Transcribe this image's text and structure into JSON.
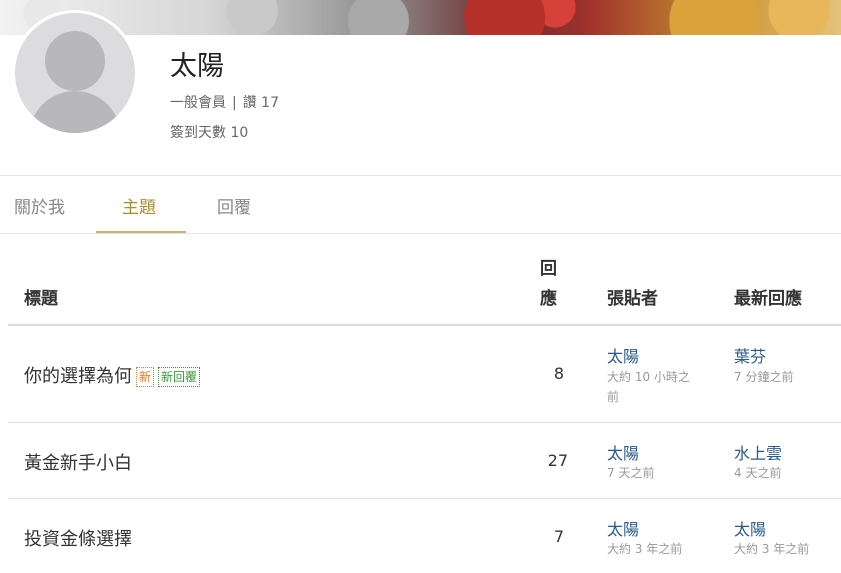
{
  "profile": {
    "name": "太陽",
    "rank": "一般會員",
    "separator": "|",
    "likes": "讚 17",
    "checkin": "簽到天數 10"
  },
  "tabs": [
    {
      "label": "關於我"
    },
    {
      "label": "主題"
    },
    {
      "label": "回覆"
    }
  ],
  "table": {
    "headers": {
      "title": "標題",
      "replies_line1": "回",
      "replies_line2": "應",
      "poster": "張貼者",
      "latest": "最新回應"
    },
    "rows": [
      {
        "title": "你的選擇為何",
        "badge_new": "新",
        "badge_reply": "新回覆",
        "replies": "8",
        "poster": "太陽",
        "poster_time_line1": "大約 10 小時之",
        "poster_time_line2": "前",
        "latest_user": "葉芬",
        "latest_time": "7 分鐘之前"
      },
      {
        "title": "黃金新手小白",
        "replies": "27",
        "poster": "太陽",
        "poster_time_line1": "7 天之前",
        "latest_user": "水上雲",
        "latest_time": "4 天之前"
      },
      {
        "title": "投資金條選擇",
        "replies": "7",
        "poster": "太陽",
        "poster_time_line1": "大約 3 年之前",
        "latest_user": "太陽",
        "latest_time": "大約 3 年之前"
      }
    ]
  },
  "colors": {
    "accent": "#a98c2e",
    "link": "#2a5a8a",
    "badge_new": "#e07b2a",
    "badge_reply": "#3a9a3a"
  }
}
